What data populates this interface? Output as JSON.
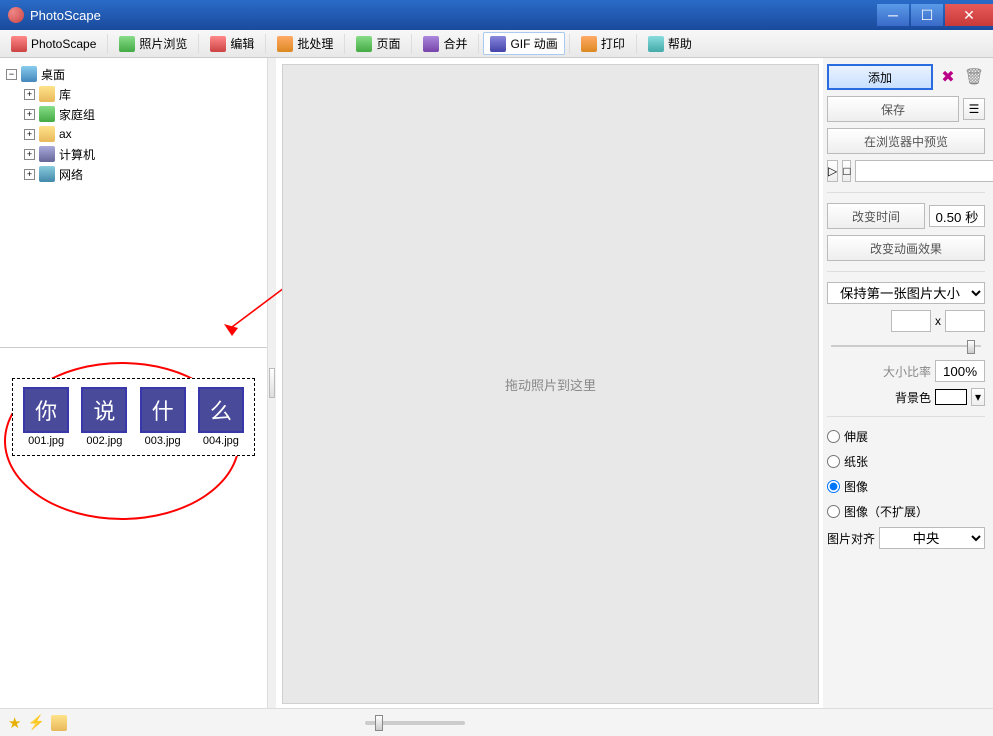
{
  "window": {
    "title": "PhotoScape"
  },
  "tabs": [
    {
      "label": "PhotoScape"
    },
    {
      "label": "照片浏览"
    },
    {
      "label": "编辑"
    },
    {
      "label": "批处理"
    },
    {
      "label": "页面"
    },
    {
      "label": "合并"
    },
    {
      "label": "GIF 动画"
    },
    {
      "label": "打印"
    },
    {
      "label": "帮助"
    }
  ],
  "tree": {
    "root": "桌面",
    "children": [
      {
        "label": "库"
      },
      {
        "label": "家庭组"
      },
      {
        "label": "ax"
      },
      {
        "label": "计算机"
      },
      {
        "label": "网络"
      }
    ]
  },
  "thumbnails": [
    {
      "char": "你",
      "name": "001.jpg"
    },
    {
      "char": "说",
      "name": "002.jpg"
    },
    {
      "char": "什",
      "name": "003.jpg"
    },
    {
      "char": "么",
      "name": "004.jpg"
    }
  ],
  "canvas": {
    "hint": "拖动照片到这里"
  },
  "rightPanel": {
    "add": "添加",
    "save": "保存",
    "previewBrowser": "在浏览器中预览",
    "changeTime": "改变时间",
    "timeValue": "0.50 秒",
    "changeEffect": "改变动画效果",
    "sizeMode": "保持第一张图片大小",
    "dimX": "x",
    "ratioLabel": "大小比率",
    "ratioValue": "100%",
    "bgLabel": "背景色",
    "radios": {
      "stretch": "伸展",
      "paper": "纸张",
      "image": "图像",
      "imageNoExpand": "图像（不扩展）"
    },
    "alignLabel": "图片对齐",
    "alignValue": "中央"
  }
}
